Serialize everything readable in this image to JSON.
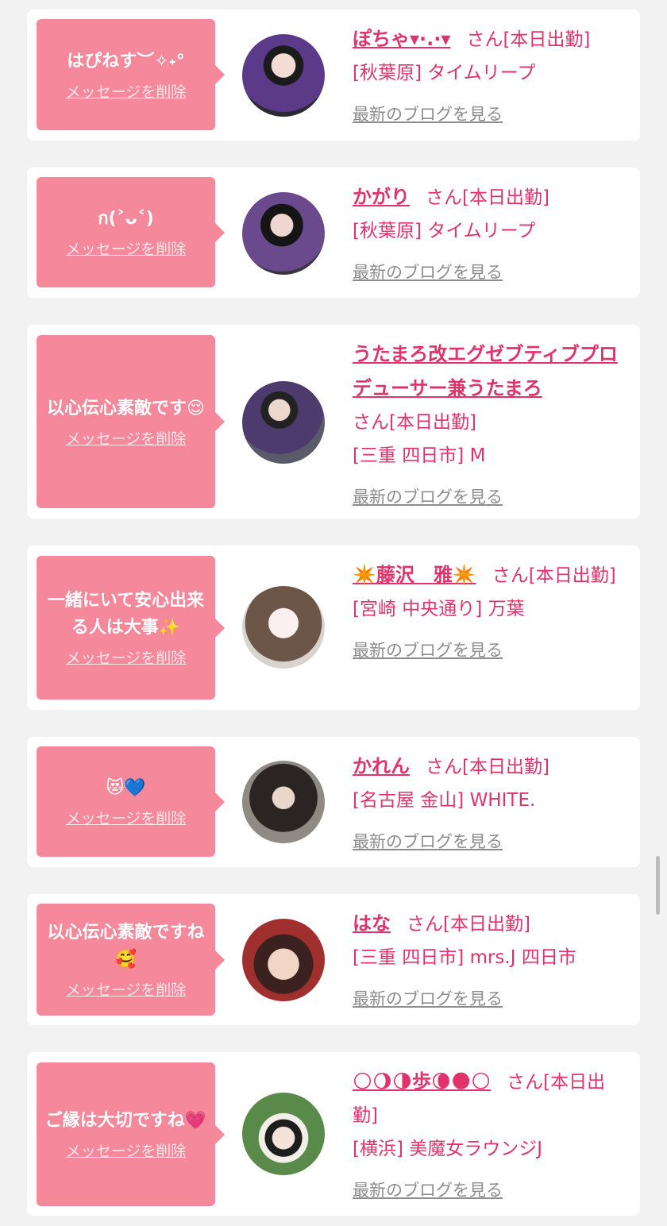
{
  "delete_label": "メッセージを削除",
  "blog_label": "最新のブログを見る",
  "honorific": "さん",
  "cards": [
    {
      "message": "はぴねす︶✧˖°",
      "name": "ぽちゃ▾·.·▾",
      "status": "[本日出勤]",
      "location": "[秋葉原] タイムリープ"
    },
    {
      "message": "ก(˃ᴗ˂)",
      "name": "かがり",
      "status": "[本日出勤]",
      "location": "[秋葉原] タイムリープ"
    },
    {
      "message": "以心伝心素敵です😌",
      "name": "うたまろ改エグゼブティブプロデューサー兼うたまろ",
      "status": "[本日出勤]",
      "location": "[三重 四日市] M"
    },
    {
      "message": "一緒にいて安心出来る人は大事✨",
      "name": "✴️藤沢　雅✴️",
      "status": "[本日出勤]",
      "location": "[宮崎 中央通り] 万葉"
    },
    {
      "message": "😻💙",
      "name": "かれん",
      "status": "[本日出勤]",
      "location": "[名古屋 金山] WHITE."
    },
    {
      "message": "以心伝心素敵ですね🥰",
      "name": "はな",
      "status": "[本日出勤]",
      "location": "[三重 四日市] mrs.J 四日市"
    },
    {
      "message": "ご縁は大切ですね💗",
      "name": "🌕🌖🌗歩🌘🌑🌕",
      "status": "[本日出勤]",
      "location": "[横浜] 美魔女ラウンジJ"
    }
  ]
}
